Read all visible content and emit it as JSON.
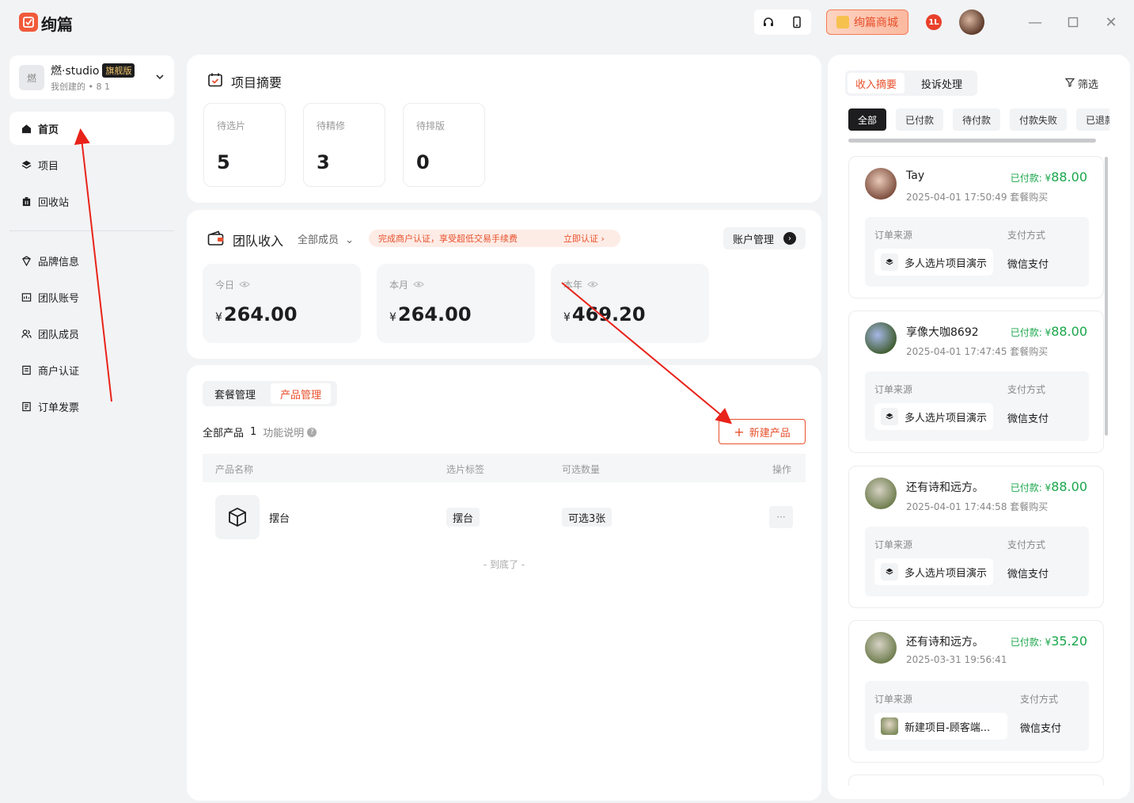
{
  "app": {
    "name": "绚篇",
    "mall_label": "绚篇商城",
    "notif_label": "1L"
  },
  "studio": {
    "avatar_text": "燃",
    "name": "燃·studio",
    "badge": "旗舰版",
    "sub": "我创建的 • 8 1"
  },
  "sidebar": {
    "items": [
      {
        "label": "首页",
        "icon": "home-icon"
      },
      {
        "label": "项目",
        "icon": "layers-icon"
      },
      {
        "label": "回收站",
        "icon": "trash-icon"
      },
      {
        "label": "品牌信息",
        "icon": "brand-icon"
      },
      {
        "label": "团队账号",
        "icon": "team-account-icon"
      },
      {
        "label": "团队成员",
        "icon": "members-icon"
      },
      {
        "label": "商户认证",
        "icon": "merchant-icon"
      },
      {
        "label": "订单发票",
        "icon": "invoice-icon"
      }
    ]
  },
  "summary": {
    "title": "项目摘要",
    "stats": [
      {
        "label": "待选片",
        "value": "5"
      },
      {
        "label": "待精修",
        "value": "3"
      },
      {
        "label": "待排版",
        "value": "0"
      }
    ]
  },
  "income": {
    "title": "团队收入",
    "members": "全部成员",
    "promo": "完成商户认证，享受超低交易手续费",
    "promo_link": "立即认证 ›",
    "account_btn": "账户管理",
    "currency": "¥",
    "boxes": [
      {
        "label": "今日",
        "value": "264.00"
      },
      {
        "label": "本月",
        "value": "264.00"
      },
      {
        "label": "本年",
        "value": "469.20"
      }
    ]
  },
  "products": {
    "tabs": [
      "套餐管理",
      "产品管理"
    ],
    "active_tab": 1,
    "all_label": "全部产品",
    "count": "1",
    "help": "功能说明",
    "new_btn": "新建产品",
    "columns": [
      "产品名称",
      "选片标签",
      "可选数量",
      "操作"
    ],
    "rows": [
      {
        "name": "摆台",
        "tag": "摆台",
        "quantity": "可选3张",
        "action": "···"
      }
    ],
    "end_note": "- 到底了 -"
  },
  "right": {
    "tabs": [
      "收入摘要",
      "投诉处理"
    ],
    "active_tab": 0,
    "filter": "筛选",
    "chips": [
      "全部",
      "已付款",
      "待付款",
      "付款失败",
      "已退款"
    ],
    "source_label": "订单来源",
    "payment_label": "支付方式",
    "orders": [
      {
        "name": "Tay",
        "time": "2025-04-01 17:50:49 套餐购买",
        "paid_label": "已付款: ¥",
        "amount": "88.00",
        "source": "多人选片项目演示",
        "payment": "微信支付"
      },
      {
        "name": "享像大咖8692",
        "time": "2025-04-01 17:47:45 套餐购买",
        "paid_label": "已付款: ¥",
        "amount": "88.00",
        "source": "多人选片项目演示",
        "payment": "微信支付"
      },
      {
        "name": "还有诗和远方。",
        "time": "2025-04-01 17:44:58 套餐购买",
        "paid_label": "已付款: ¥",
        "amount": "88.00",
        "source": "多人选片项目演示",
        "payment": "微信支付"
      },
      {
        "name": "还有诗和远方。",
        "time": "2025-03-31 19:56:41",
        "paid_label": "已付款: ¥",
        "amount": "35.20",
        "source": "新建项目-顾客端...",
        "payment": "微信支付"
      }
    ]
  },
  "colors": {
    "accent": "#e8502c",
    "paid": "#1aa64a",
    "annotation_arrow": "#e8231a"
  }
}
